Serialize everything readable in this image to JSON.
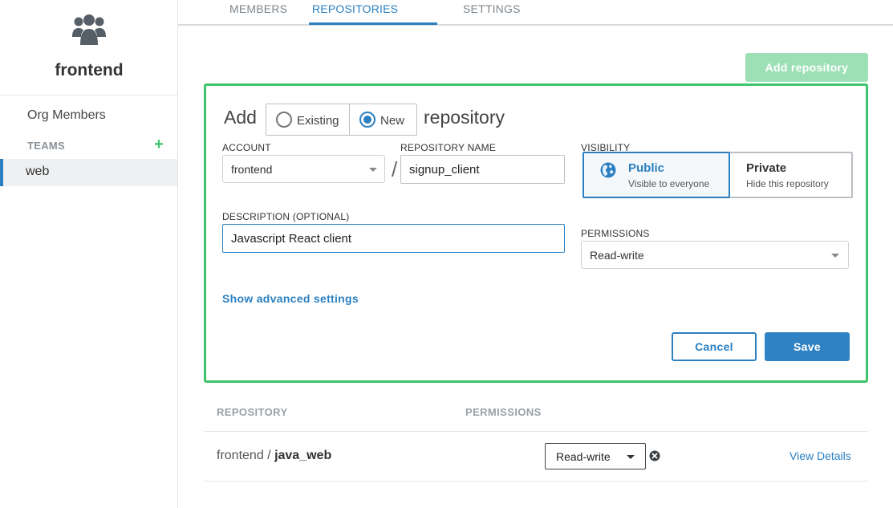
{
  "sidebar": {
    "org_name": "frontend",
    "org_members_label": "Org Members",
    "teams_label": "TEAMS",
    "add_team_glyph": "+",
    "teams": [
      {
        "label": "web",
        "selected": true
      }
    ]
  },
  "tabs": [
    {
      "label": "MEMBERS",
      "active": false
    },
    {
      "label": "REPOSITORIES",
      "active": true
    },
    {
      "label": "SETTINGS",
      "active": false
    }
  ],
  "add_repository_button": "Add repository",
  "form": {
    "add_word": "Add",
    "repository_word": "repository",
    "mode_options": [
      {
        "label": "Existing",
        "checked": false
      },
      {
        "label": "New",
        "checked": true
      }
    ],
    "account": {
      "label": "ACCOUNT",
      "value": "frontend"
    },
    "separator": "/",
    "repository_name": {
      "label": "REPOSITORY NAME",
      "value": "signup_client"
    },
    "visibility": {
      "label": "VISIBILITY",
      "options": [
        {
          "title": "Public",
          "subtitle": "Visible to everyone",
          "selected": true,
          "icon": "globe-icon"
        },
        {
          "title": "Private",
          "subtitle": "Hide this repository",
          "selected": false
        }
      ]
    },
    "description": {
      "label": "DESCRIPTION (OPTIONAL)",
      "value": "Javascript React client"
    },
    "permissions": {
      "label": "PERMISSIONS",
      "value": "Read-write"
    },
    "advanced_link": "Show advanced settings",
    "cancel_label": "Cancel",
    "save_label": "Save"
  },
  "table": {
    "headers": {
      "repository": "REPOSITORY",
      "permissions": "PERMISSIONS"
    },
    "rows": [
      {
        "account": "frontend",
        "separator": " / ",
        "repo": "java_web",
        "permission": "Read-write",
        "details_label": "View Details"
      }
    ]
  },
  "colors": {
    "accent": "#2b80c1",
    "success": "#3ec46d",
    "disabled_success": "#9ee0b6"
  }
}
